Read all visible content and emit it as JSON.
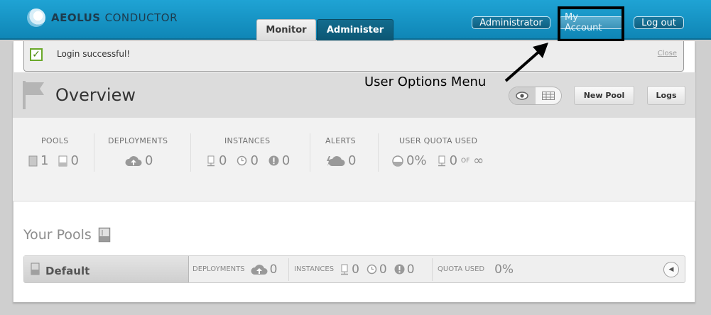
{
  "app": {
    "logo_bold": "AEOLUS",
    "logo_light": "CONDUCTOR"
  },
  "tabs": [
    {
      "label": "Monitor"
    },
    {
      "label": "Administer"
    }
  ],
  "header": {
    "admin_label": "Administrator",
    "account_label": "My Account",
    "logout_label": "Log out"
  },
  "flash": {
    "message": "Login successful!",
    "close_label": "Close"
  },
  "annotation": {
    "text": "User Options Menu"
  },
  "overview": {
    "title": "Overview",
    "new_pool_label": "New Pool",
    "logs_label": "Logs"
  },
  "stats": {
    "pools": {
      "label": "POOLS",
      "total": "1",
      "empty": "0"
    },
    "deployments": {
      "label": "DEPLOYMENTS",
      "count": "0"
    },
    "instances": {
      "label": "INSTANCES",
      "running": "0",
      "pending": "0",
      "failed": "0"
    },
    "alerts": {
      "label": "ALERTS",
      "count": "0"
    },
    "quota": {
      "label": "USER QUOTA USED",
      "percent": "0%",
      "used": "0",
      "of_label": "OF",
      "limit": "∞"
    }
  },
  "your_pools": {
    "title": "Your Pools"
  },
  "pools": [
    {
      "name": "Default",
      "deployments_label": "DEPLOYMENTS",
      "deployments": "0",
      "instances_label": "INSTANCES",
      "running": "0",
      "pending": "0",
      "failed": "0",
      "quota_label": "QUOTA USED",
      "quota": "0%"
    }
  ],
  "colors": {
    "header": "#1599c9",
    "accent_dark": "#0c5673",
    "success": "#6aa82a"
  }
}
